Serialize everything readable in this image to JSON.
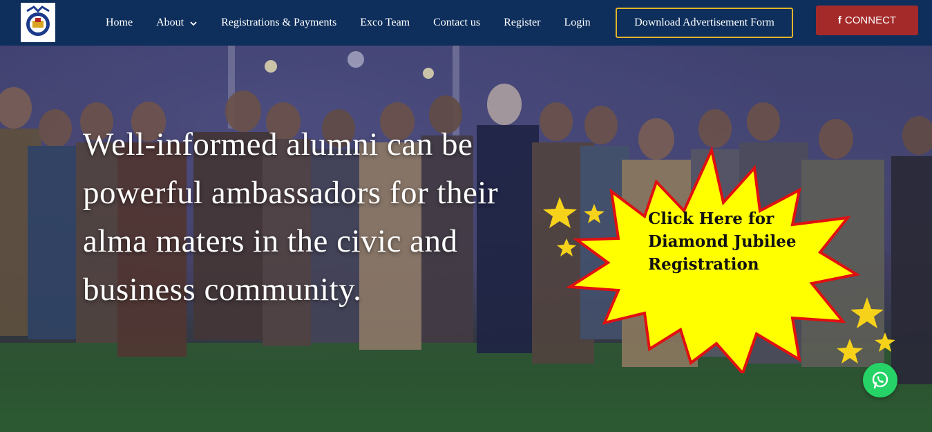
{
  "nav": {
    "items": [
      {
        "label": "Home"
      },
      {
        "label": "About"
      },
      {
        "label": "Registrations & Payments"
      },
      {
        "label": "Exco Team"
      },
      {
        "label": "Contact us"
      },
      {
        "label": "Register"
      },
      {
        "label": "Login"
      }
    ],
    "download_label": "Download Advertisement Form",
    "connect_label": "CONNECT"
  },
  "hero": {
    "headline": "Well-informed alumni can be powerful ambassadors for their alma maters in the civic and business community."
  },
  "promo": {
    "line1": "Click Here for",
    "line2": "Diamond Jubilee",
    "line3": "Registration"
  },
  "colors": {
    "navbar": "#0e2f5c",
    "download_border": "#e4b42a",
    "connect_bg": "#a42a2a",
    "burst_fill": "#ffff00",
    "burst_outline": "#e01010",
    "whatsapp": "#25d366"
  },
  "icons": {
    "about_dropdown": "chevron-down-icon",
    "connect": "facebook-icon",
    "whatsapp": "whatsapp-icon"
  }
}
